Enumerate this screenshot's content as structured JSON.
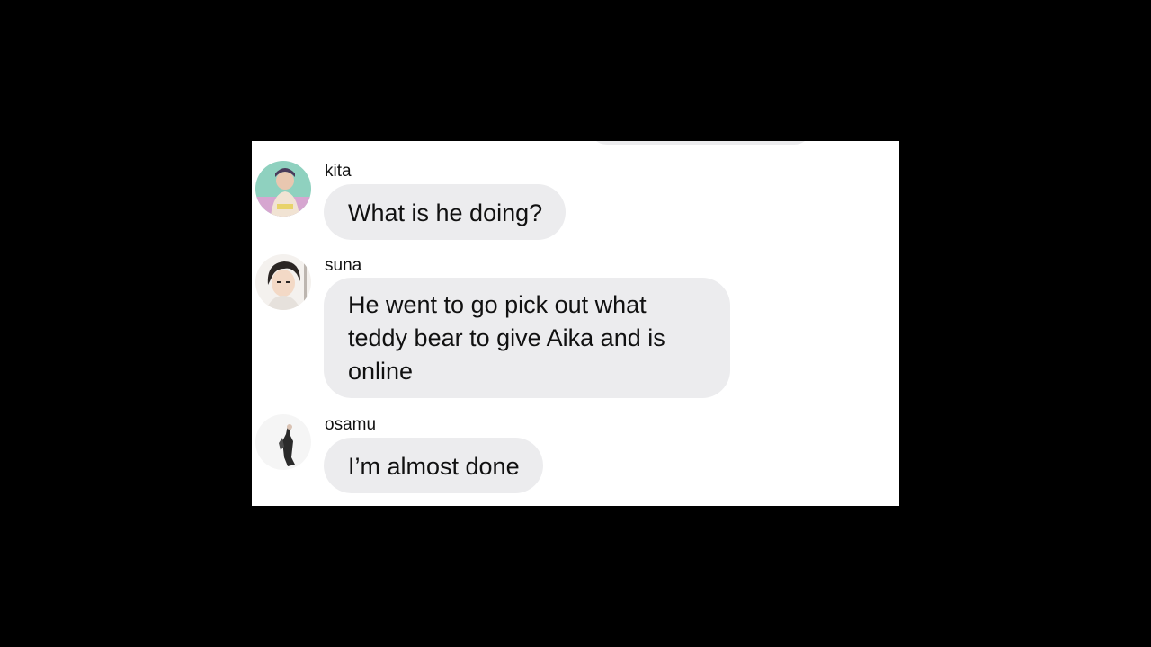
{
  "messages": [
    {
      "sender": "kita",
      "text": "What is he doing?",
      "avatar_icon": "kita-avatar"
    },
    {
      "sender": "suna",
      "text": "He went to go pick out what teddy bear to give Aika and is online",
      "avatar_icon": "suna-avatar"
    },
    {
      "sender": "osamu",
      "text": "I’m almost done",
      "avatar_icon": "osamu-avatar"
    }
  ],
  "colors": {
    "background": "#000000",
    "chat_background": "#ffffff",
    "bubble": "#ececee",
    "text": "#111111"
  }
}
